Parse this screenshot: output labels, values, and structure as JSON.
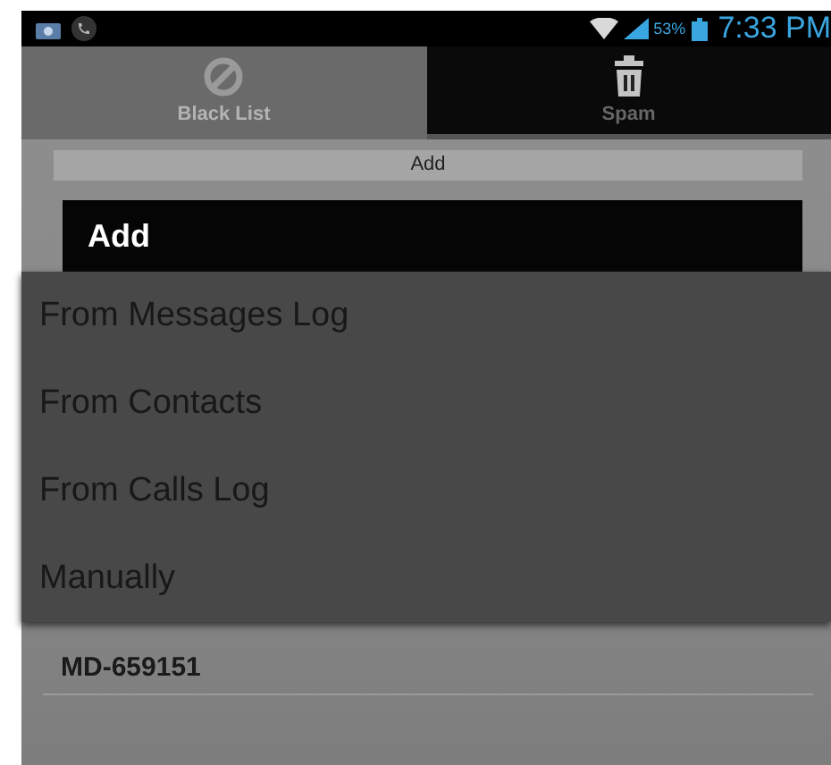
{
  "status_bar": {
    "battery": "53%",
    "time": "7:33 PM"
  },
  "tabs": [
    {
      "label": "Black List",
      "kind": "block",
      "selected": true
    },
    {
      "label": "Spam",
      "kind": "trash",
      "selected": false
    }
  ],
  "section_header": "Add",
  "list": {
    "rows": [
      "MD-659151"
    ]
  },
  "menu": {
    "title": "Add",
    "items": [
      "From Messages Log",
      "From Contacts",
      "From Calls Log",
      "Manually"
    ]
  }
}
